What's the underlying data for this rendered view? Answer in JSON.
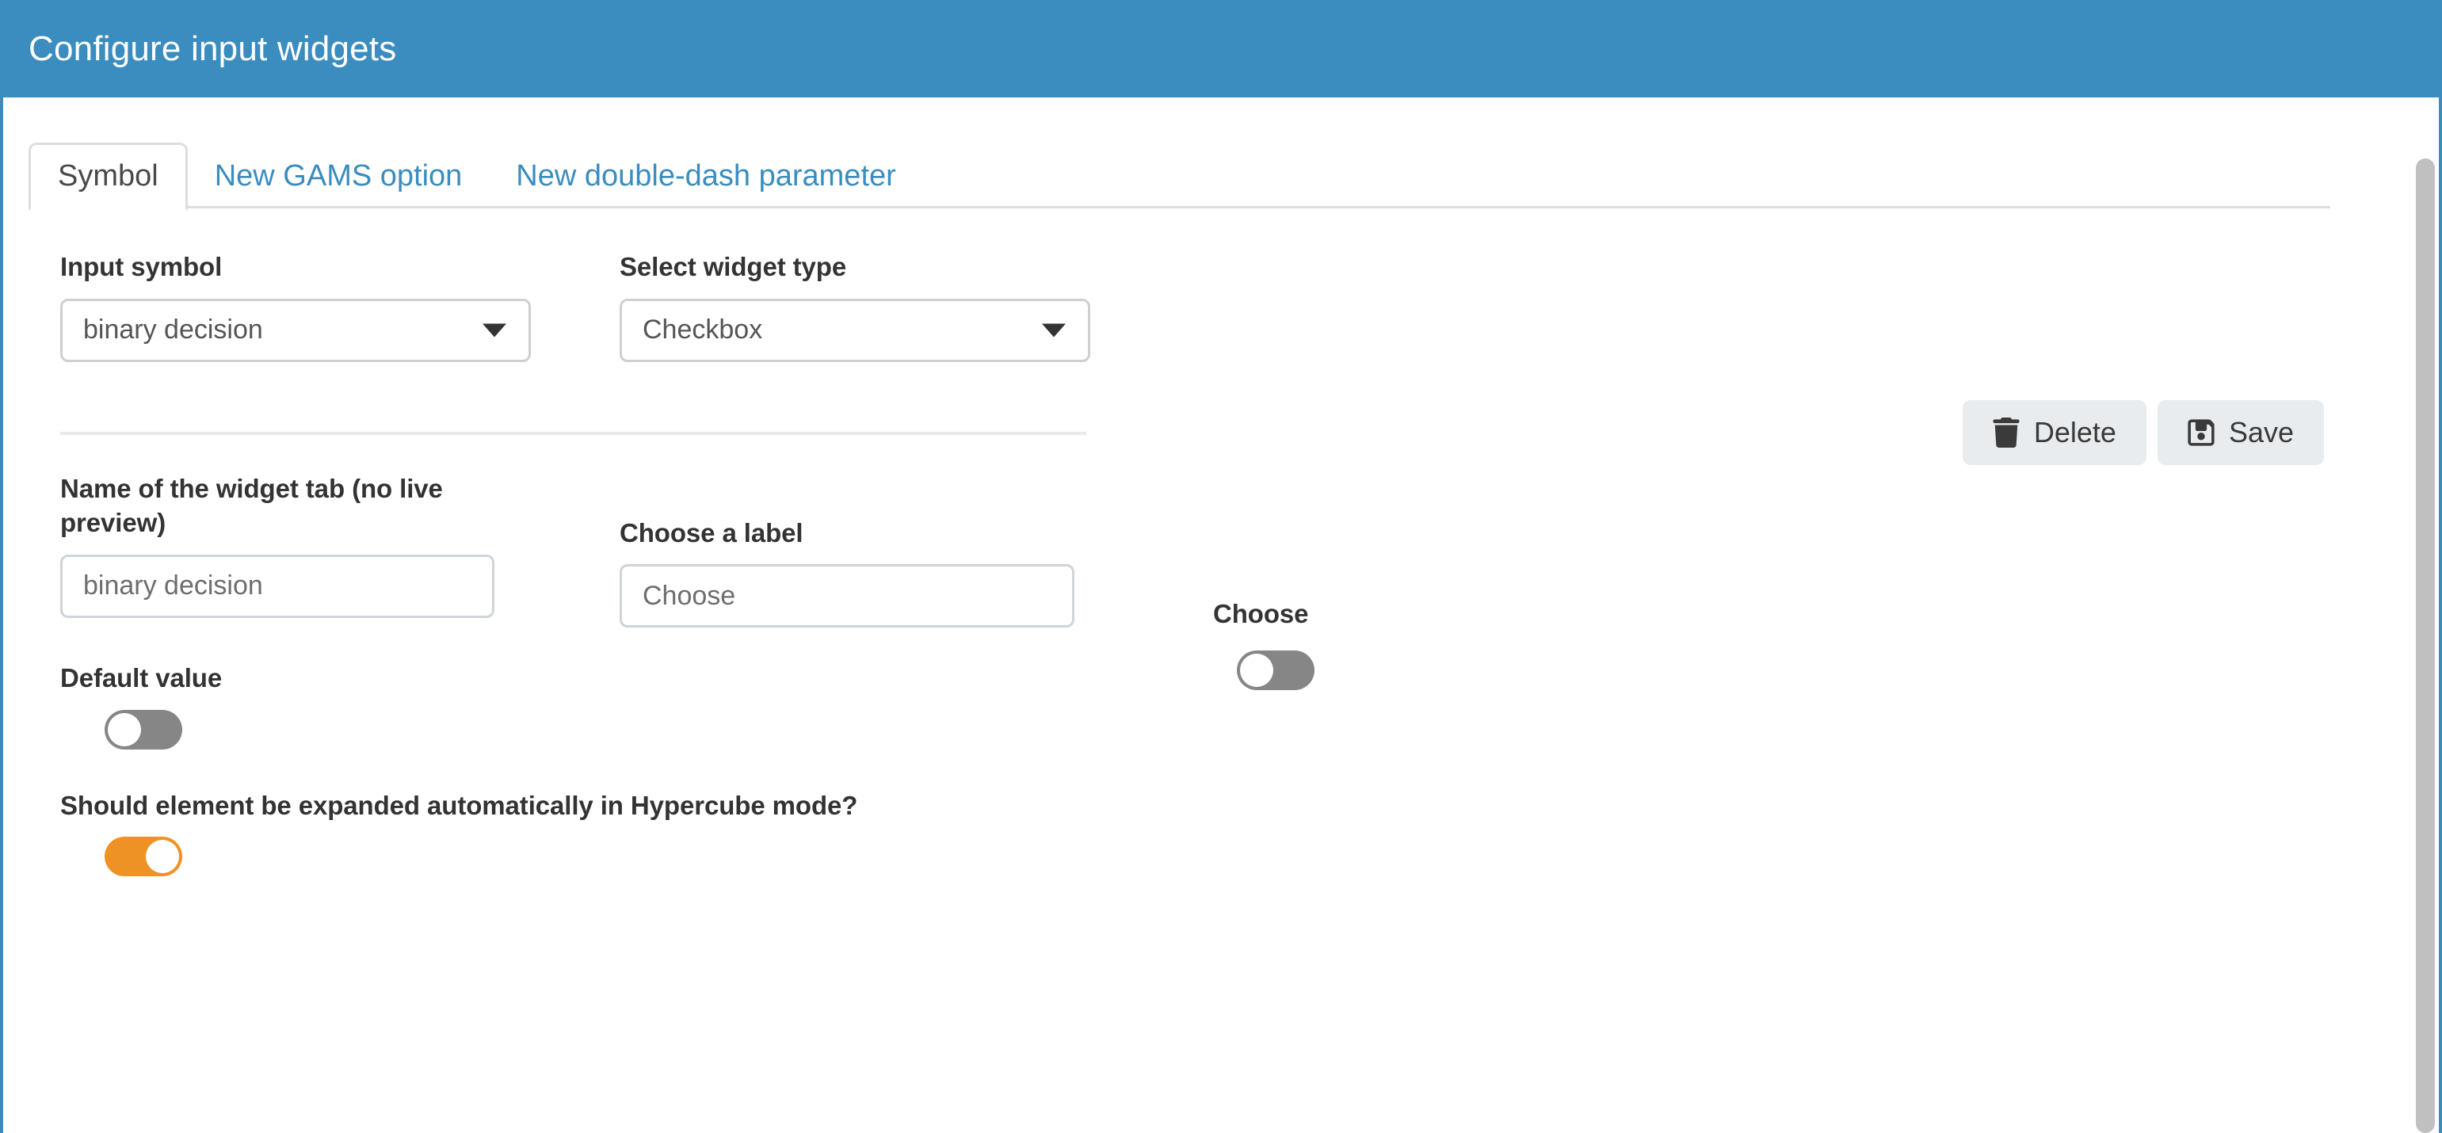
{
  "window": {
    "title": "Configure input widgets",
    "header_color": "#3a8dbe",
    "accent_orange": "#ef9226",
    "link_color": "#3a8dbe"
  },
  "tabs": [
    {
      "label": "Symbol",
      "active": true
    },
    {
      "label": "New GAMS option",
      "active": false
    },
    {
      "label": "New double-dash parameter",
      "active": false
    }
  ],
  "form": {
    "input_symbol": {
      "label": "Input symbol",
      "value": "binary decision",
      "icon": "chevron-down-icon"
    },
    "widget_type": {
      "label": "Select widget type",
      "value": "Checkbox",
      "icon": "chevron-down-icon"
    },
    "widget_tab_name": {
      "label": "Name of the widget tab (no live preview)",
      "value": "binary decision",
      "placeholder": "binary decision"
    },
    "choose_a_label": {
      "label": "Choose a label",
      "value": "Choose",
      "placeholder": "Choose"
    },
    "default_value": {
      "label": "Default value",
      "state": "off"
    },
    "hypercube": {
      "label": "Should element be expanded automatically in Hypercube mode?",
      "state": "on"
    }
  },
  "preview": {
    "label": "Choose",
    "state": "off"
  },
  "actions": {
    "delete_label": "Delete",
    "delete_icon": "trash-icon",
    "save_label": "Save",
    "save_icon": "floppy-save-icon"
  }
}
